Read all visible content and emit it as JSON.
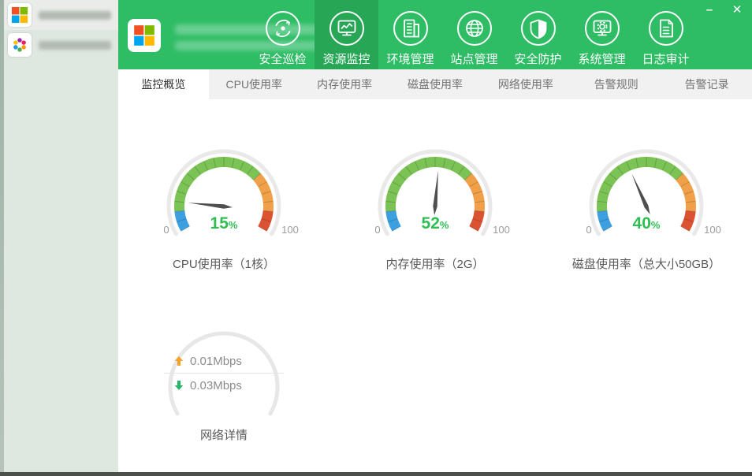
{
  "window": {
    "minimize_label": "–",
    "close_label": "✕"
  },
  "colors": {
    "header_green": "#2ebd64",
    "header_green_selected": "#27a756",
    "sidebar_bg": "#dfe7e1",
    "tabbar_bg": "#f0f1f0",
    "tab_selected_bg": "#ffffff",
    "value_green": "#2fbe53",
    "ring_gray": "#e9e9e9",
    "needle": "#4f4f4f",
    "minmax_gray": "#9b9b9b"
  },
  "sidebar": {
    "items": [
      {
        "icon": "windows-logo",
        "selected": true
      },
      {
        "icon": "app-flower-logo",
        "selected": false
      }
    ]
  },
  "header": {
    "logo_icon": "windows-logo",
    "nav": [
      {
        "label": "安全巡检",
        "icon": "security-inspect-icon",
        "selected": false
      },
      {
        "label": "资源监控",
        "icon": "resource-monitor-icon",
        "selected": true
      },
      {
        "label": "环境管理",
        "icon": "environment-icon",
        "selected": false
      },
      {
        "label": "站点管理",
        "icon": "site-globe-icon",
        "selected": false
      },
      {
        "label": "安全防护",
        "icon": "shield-icon",
        "selected": false
      },
      {
        "label": "系统管理",
        "icon": "system-gear-icon",
        "selected": false
      },
      {
        "label": "日志审计",
        "icon": "log-audit-icon",
        "selected": false
      }
    ]
  },
  "tabs": [
    {
      "label": "监控概览",
      "selected": true
    },
    {
      "label": "CPU使用率",
      "selected": false
    },
    {
      "label": "内存使用率",
      "selected": false
    },
    {
      "label": "磁盘使用率",
      "selected": false
    },
    {
      "label": "网络使用率",
      "selected": false
    },
    {
      "label": "告警规则",
      "selected": false
    },
    {
      "label": "告警记录",
      "selected": false
    }
  ],
  "chart_data": [
    {
      "type": "gauge",
      "title": "CPU使用率（1核）",
      "value": 15,
      "unit": "%",
      "min": 0,
      "max": 100,
      "min_label": "0",
      "max_label": "100",
      "start_angle": 210,
      "end_angle": -30,
      "tick_step": 5,
      "segments": [
        {
          "from": 0,
          "to": 10,
          "color": "#3c9fe0"
        },
        {
          "from": 10,
          "to": 70,
          "color": "#7cc356"
        },
        {
          "from": 70,
          "to": 90,
          "color": "#efa048"
        },
        {
          "from": 90,
          "to": 100,
          "color": "#db5233"
        }
      ]
    },
    {
      "type": "gauge",
      "title": "内存使用率（2G）",
      "value": 52,
      "unit": "%",
      "min": 0,
      "max": 100,
      "min_label": "0",
      "max_label": "100",
      "start_angle": 210,
      "end_angle": -30,
      "tick_step": 5,
      "segments": [
        {
          "from": 0,
          "to": 10,
          "color": "#3c9fe0"
        },
        {
          "from": 10,
          "to": 70,
          "color": "#7cc356"
        },
        {
          "from": 70,
          "to": 90,
          "color": "#efa048"
        },
        {
          "from": 90,
          "to": 100,
          "color": "#db5233"
        }
      ]
    },
    {
      "type": "gauge",
      "title": "磁盘使用率（总大小50GB）",
      "value": 40,
      "unit": "%",
      "min": 0,
      "max": 100,
      "min_label": "0",
      "max_label": "100",
      "start_angle": 210,
      "end_angle": -30,
      "tick_step": 5,
      "segments": [
        {
          "from": 0,
          "to": 10,
          "color": "#3c9fe0"
        },
        {
          "from": 10,
          "to": 70,
          "color": "#7cc356"
        },
        {
          "from": 70,
          "to": 90,
          "color": "#efa048"
        },
        {
          "from": 90,
          "to": 100,
          "color": "#db5233"
        }
      ]
    }
  ],
  "network": {
    "title": "网络详情",
    "upload": "0.01Mbps",
    "download": "0.03Mbps",
    "up_arrow_color": "#f5a226",
    "down_arrow_color": "#22b866"
  }
}
